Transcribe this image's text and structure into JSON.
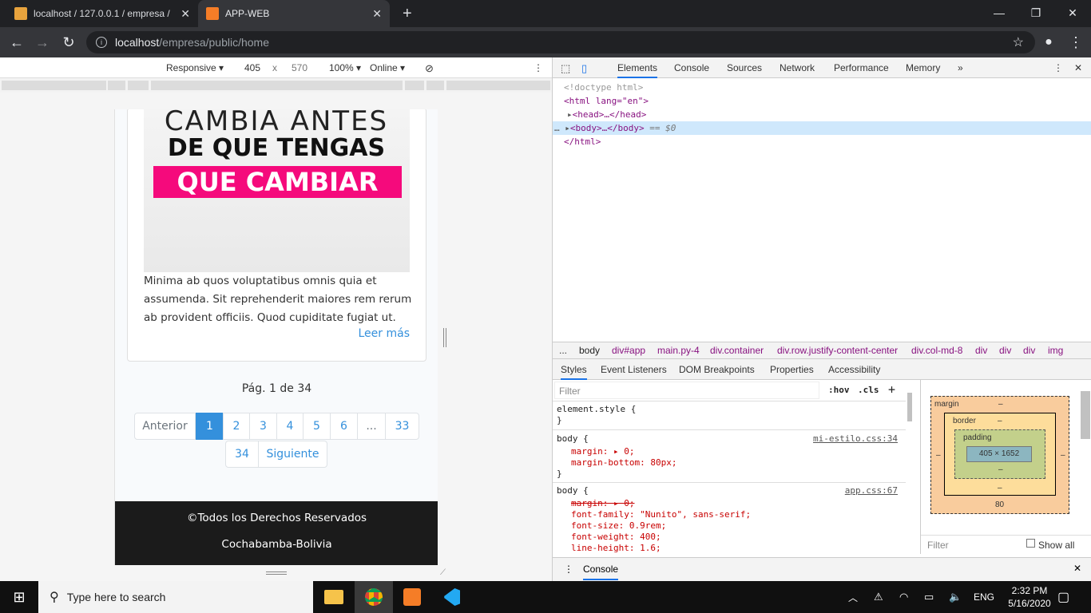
{
  "browser": {
    "tabs": [
      {
        "title": "localhost / 127.0.0.1 / empresa /",
        "active": false
      },
      {
        "title": "APP-WEB",
        "active": true
      }
    ],
    "url_host": "localhost",
    "url_path": "/empresa/public/home"
  },
  "device_toolbar": {
    "mode": "Responsive",
    "width": "405",
    "times": "x",
    "height": "570",
    "zoom": "100%",
    "network": "Online"
  },
  "page": {
    "banner_line1": "CAMBIA ANTES",
    "banner_line2": "DE QUE TENGAS",
    "banner_line3": "QUE CAMBIAR",
    "excerpt": "Minima ab quos voluptatibus omnis quia et assumenda. Sit reprehenderit maiores rem rerum ab provident officiis. Quod cupiditate fugiat ut.",
    "read_more": "Leer más",
    "page_status": "Pág. 1 de 34",
    "pagination": {
      "prev": "Anterior",
      "pages": [
        "1",
        "2",
        "3",
        "4",
        "5",
        "6",
        "...",
        "33",
        "34"
      ],
      "next": "Siguiente",
      "current": "1"
    },
    "footer_line1": "©Todos los Derechos Reservados",
    "footer_line2": "Cochabamba-Bolivia"
  },
  "devtools": {
    "tabs": [
      "Elements",
      "Console",
      "Sources",
      "Network",
      "Performance",
      "Memory",
      "»"
    ],
    "active_tab": "Elements",
    "dom": {
      "doctype": "<!doctype html>",
      "html_open": "<html lang=\"en\">",
      "head": "<head>…</head>",
      "body": "<body>…</body>",
      "body_marker": "== $0",
      "html_close": "</html>"
    },
    "breadcrumbs": [
      "...",
      "body",
      "div#app",
      "main.py-4",
      "div.container",
      "div.row.justify-content-center",
      "div.col-md-8",
      "div",
      "div",
      "div",
      "img"
    ],
    "sub_tabs": [
      "Styles",
      "Event Listeners",
      "DOM Breakpoints",
      "Properties",
      "Accessibility"
    ],
    "styles": {
      "filter_placeholder": "Filter",
      "hov": ":hov",
      "cls": ".cls",
      "rules": [
        {
          "selector": "element.style {",
          "close": "}"
        },
        {
          "selector": "body {",
          "source": "mi-estilo.css:34",
          "props": [
            "margin: ▸ 0;",
            "margin-bottom: 80px;"
          ]
        },
        {
          "selector": "body {",
          "source": "app.css:67",
          "props": [
            "margin: ▸ 0;",
            "font-family: \"Nunito\", sans-serif;",
            "font-size: 0.9rem;",
            "font-weight: 400;",
            "line-height: 1.6;"
          ]
        }
      ]
    },
    "box_model": {
      "margin_label": "margin",
      "border_label": "border",
      "padding_label": "padding",
      "dash": "–",
      "content": "405 × 1652",
      "margin_bottom": "80",
      "filter_placeholder": "Filter",
      "show_all": "Show all"
    },
    "console_drawer": "Console"
  },
  "taskbar": {
    "search_placeholder": "Type here to search",
    "language": "ENG",
    "time": "2:32 PM",
    "date": "5/16/2020"
  },
  "colors": {
    "accent": "#3490dc",
    "banner_pink": "#f50a7c",
    "footer": "#1b1b1b"
  }
}
